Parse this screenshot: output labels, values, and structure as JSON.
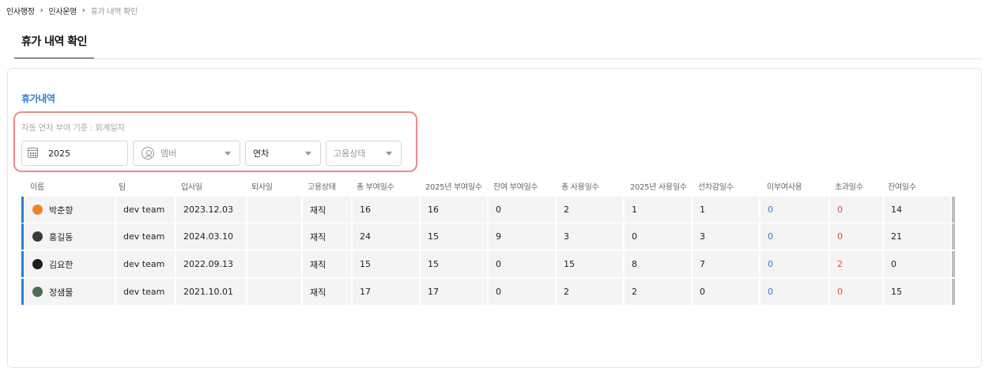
{
  "breadcrumb": {
    "items": [
      "인사행정",
      "인사운영",
      "휴가 내역 확인"
    ],
    "separator": "›"
  },
  "page_tab": "휴가 내역 확인",
  "section_title": "휴가내역",
  "filters": {
    "hint": "자동 연차 부여 기준 : 회계일자",
    "year": "2025",
    "member_placeholder": "멤버",
    "leave_type": "연차",
    "employment_status_placeholder": "고용상태"
  },
  "table": {
    "headers": [
      "이름",
      "팀",
      "입사일",
      "퇴사일",
      "고용상태",
      "총 부여일수",
      "2025년 부여일수",
      "잔여 부여일수",
      "총 사용일수",
      "2025년 사용일수",
      "선차감일수",
      "미부여사용",
      "초과일수",
      "잔여일수"
    ],
    "rows": [
      {
        "name": "박춘향",
        "team": "dev team",
        "hire_date": "2023.12.03",
        "leave_date": "",
        "status": "재직",
        "total_granted": "16",
        "granted_2025": "16",
        "remaining_granted": "0",
        "total_used": "2",
        "used_2025": "1",
        "pre_deducted": "1",
        "ungranted_used": "0",
        "excess": "0",
        "remaining": "14",
        "avatar_color": "#e8862c"
      },
      {
        "name": "홍길동",
        "team": "dev team",
        "hire_date": "2024.03.10",
        "leave_date": "",
        "status": "재직",
        "total_granted": "24",
        "granted_2025": "15",
        "remaining_granted": "9",
        "total_used": "3",
        "used_2025": "0",
        "pre_deducted": "3",
        "ungranted_used": "0",
        "excess": "0",
        "remaining": "21",
        "avatar_color": "#3a3a3a"
      },
      {
        "name": "김요한",
        "team": "dev team",
        "hire_date": "2022.09.13",
        "leave_date": "",
        "status": "재직",
        "total_granted": "15",
        "granted_2025": "15",
        "remaining_granted": "0",
        "total_used": "15",
        "used_2025": "8",
        "pre_deducted": "7",
        "ungranted_used": "0",
        "excess": "2",
        "remaining": "0",
        "avatar_color": "#1f1f1f"
      },
      {
        "name": "정샘물",
        "team": "dev team",
        "hire_date": "2021.10.01",
        "leave_date": "",
        "status": "재직",
        "total_granted": "17",
        "granted_2025": "17",
        "remaining_granted": "0",
        "total_used": "2",
        "used_2025": "2",
        "pre_deducted": "0",
        "ungranted_used": "0",
        "excess": "0",
        "remaining": "15",
        "avatar_color": "#4f6b55"
      }
    ]
  },
  "colors": {
    "accent": "#2b7bd6",
    "highlight_border": "#e98a92",
    "excess_red": "#e24b4b"
  }
}
